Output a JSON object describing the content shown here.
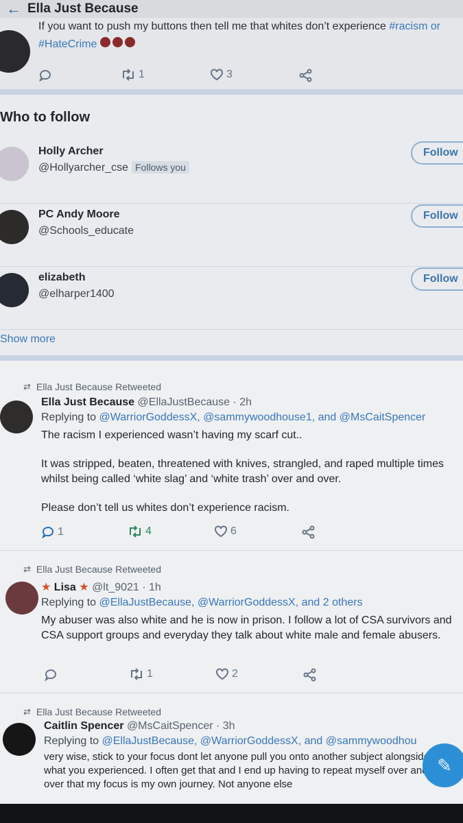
{
  "header": {
    "title": "Ella Just Because"
  },
  "top_tweet": {
    "text_line1": "If you want to push my buttons then tell me that whites don’t experience ",
    "hashtag1": "#racism or",
    "hashtag2": "#HateCrime",
    "replies": "",
    "retweets": "1",
    "likes": "3"
  },
  "who_to_follow": {
    "title": "Who to follow",
    "show_more": "Show more",
    "follow_label": "Follow",
    "accounts": [
      {
        "name": "Holly Archer",
        "handle": "@Hollyarcher_cse",
        "badge": "Follows you"
      },
      {
        "name": "PC Andy Moore",
        "handle": "@Schools_educate"
      },
      {
        "name": "elizabeth",
        "handle": "@elharper1400"
      }
    ]
  },
  "tweets": [
    {
      "retweeted_by": "Ella Just Because Retweeted",
      "name": "Ella Just Because",
      "meta": "@EllaJustBecause · 2h",
      "replying_prefix": "Replying to ",
      "replying_to": "@WarriorGoddessX, @sammywoodhouse1, and @MsCaitSpencer",
      "body": [
        "The racism I experienced wasn’t having my scarf cut..",
        "It was stripped, beaten, threatened with knives, strangled, and raped multiple times whilst being called ‘white slag’ and ‘white trash’ over and over.",
        "Please don’t tell us whites don’t experience racism."
      ],
      "replies": "1",
      "retweets": "4",
      "likes": "6"
    },
    {
      "retweeted_by": "Ella Just Because Retweeted",
      "name": "Lisa",
      "meta": "@lt_9021 · 1h",
      "replying_prefix": "Replying to ",
      "replying_to": "@EllaJustBecause, @WarriorGoddessX, and 2 others",
      "body": [
        "My abuser was also white and he is now in prison. I follow a lot of CSA survivors and CSA support groups and everyday they talk about white male and female abusers."
      ],
      "replies": "",
      "retweets": "1",
      "likes": "2"
    },
    {
      "retweeted_by": "Ella Just Because Retweeted",
      "name": "Caitlin Spencer",
      "meta": "@MsCaitSpencer · 3h",
      "replying_prefix": "Replying to ",
      "replying_to": "@EllaJustBecause, @WarriorGoddessX, and @sammywoodhou",
      "body": [
        "very wise, stick to your focus dont let anyone pull you onto another subject alongside what you experienced. I often get that and I end up having to repeat myself over and over that my focus is my own journey. Not anyone else"
      ]
    }
  ],
  "colors": {
    "link": "#3a77b8",
    "accent": "#2c8fd6",
    "heart_dots": "#8b2a2a"
  }
}
